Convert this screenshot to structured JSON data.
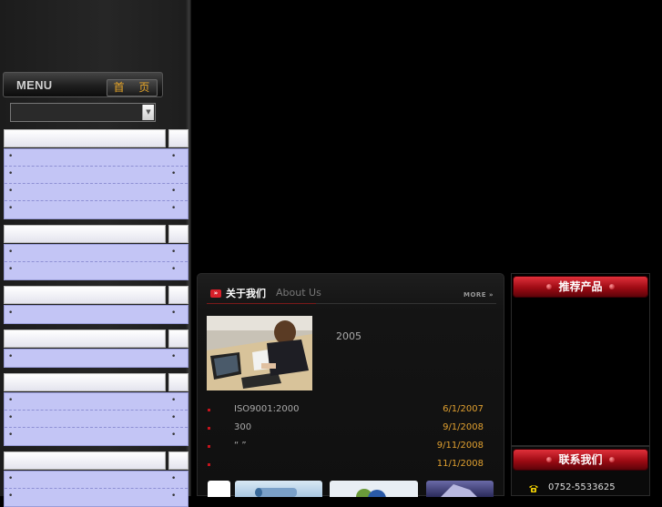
{
  "sidebar": {
    "menu_label": "MENU",
    "home_label": "首 页",
    "search_select": {
      "value": "",
      "arrow_icon": "chevron-down-icon"
    },
    "categories": [
      {
        "header": "",
        "items": [
          "",
          "",
          "",
          ""
        ]
      },
      {
        "header": "",
        "items": [
          "",
          ""
        ]
      },
      {
        "header": "",
        "items": [
          ""
        ]
      },
      {
        "header": "",
        "items": [
          ""
        ]
      },
      {
        "header": "",
        "items": [
          "",
          "",
          ""
        ]
      },
      {
        "header": "",
        "items": [
          "",
          ""
        ]
      }
    ],
    "bullet": "•"
  },
  "about": {
    "title": "关于我们",
    "subtitle": "About Us",
    "more": "MORE",
    "arrow_icon": "double-chevron-right-icon",
    "year_text": "2005",
    "news": [
      {
        "title": "ISO9001:2000",
        "date": "6/1/2007"
      },
      {
        "title": "300",
        "date": "9/1/2008"
      },
      {
        "title": "“    ”",
        "date": "9/11/2008"
      },
      {
        "title": "",
        "date": "11/1/2008"
      }
    ]
  },
  "recommend": {
    "title": "推荐产品"
  },
  "contact": {
    "title": "联系我们",
    "phone": "0752-5533625",
    "phone_icon": "telephone-icon"
  },
  "colors": {
    "accent_red": "#b10f18",
    "date_orange": "#e0a030",
    "menu_gold": "#e8a628",
    "category_blue": "#c3c5f5"
  }
}
